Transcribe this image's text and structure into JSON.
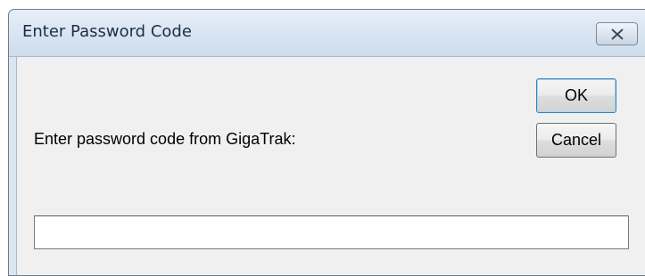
{
  "window": {
    "title": "Enter Password Code"
  },
  "dialog": {
    "prompt": "Enter password code from GigaTrak:",
    "ok_label": "OK",
    "cancel_label": "Cancel",
    "password_value": "",
    "close_icon": "close-icon"
  }
}
